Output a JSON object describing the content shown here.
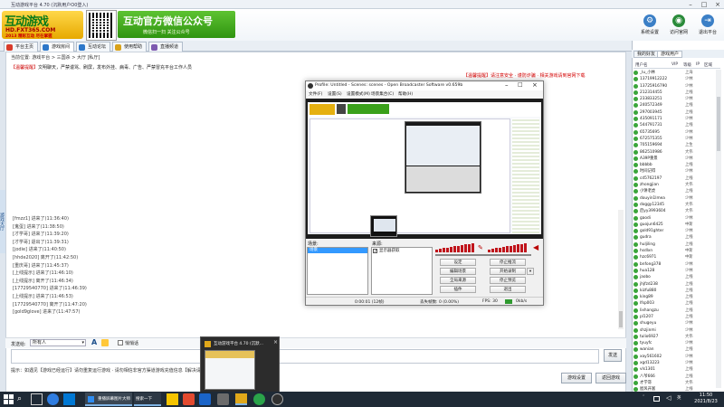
{
  "window": {
    "title": "互动游戏平台 4.70 (沉默用户O0登入)"
  },
  "banner": {
    "logo_main": "互动游戏",
    "logo_url": "HD.FXT365.COM",
    "logo_slogan": "2013 精彩互动 尽在掌握",
    "wechat_title": "互动官方微信公众号",
    "wechat_sub": "微信扫一扫 关注公众号"
  },
  "topbuttons": [
    {
      "label": "系统设置",
      "color": "#3b7fc6",
      "glyph": "⚙"
    },
    {
      "label": "访问官网",
      "color": "#2a8b3a",
      "glyph": "◉"
    },
    {
      "label": "退出平台",
      "color": "#3b7fc6",
      "glyph": "⇥"
    }
  ],
  "tabs": [
    {
      "label": "平台主页",
      "color": "#d93c2b"
    },
    {
      "label": "游戏房间",
      "color": "#2d77c9"
    },
    {
      "label": "互动论坛",
      "color": "#2d77c9"
    },
    {
      "label": "使用帮助",
      "color": "#d9a21b"
    },
    {
      "label": "直播频道",
      "color": "#7e5ab0"
    }
  ],
  "nav": "当前位置: 游戏平台 > 三国杀 > 大厅 [私厅]",
  "hint": {
    "prefix": "【温馨提醒】",
    "text": "文明聊天，严禁谩骂、刷屏，发布外挂、病毒、广告、严禁冒充平台工作人员"
  },
  "right_notice": "【温馨提醒】请注意安全 · 谨防诈骗 · 相关游戏请到官网下载",
  "side_label": "游戏大厅",
  "chat_log": [
    "[fmzz1] 进来了(11:36:40)",
    "[鬼蛋] 进来了(11:38:50)",
    "[才学哥] 进来了(11:39:20)",
    "[才学哥] 退出了(11:39:31)",
    "[jodie] 进来了(11:40:50)",
    "[hhde2020] 离开了(11:42:50)",
    "[重庆哥] 进来了(11:45:37)",
    "[上线提示] 进来了(11:46:10)",
    "[上线提示] 离开了(11:46:34)",
    "[17729540770] 进来了(11:46:39)",
    "[上线提示] 进来了(11:46:53)",
    "[17729540770] 离开了(11:47:20)",
    "[gold9glove] 进来了(11:47:57)"
  ],
  "send": {
    "label": "发送给:",
    "target": "所有人",
    "private_label": "悄悄话",
    "button": "发送"
  },
  "bottom_tip": "提示：如遇见【游戏已经运行】请勿重复运行游戏 · 请勿相信非官方渠道游戏充值信息【解决请求游戏已启动】",
  "bottom_buttons": [
    "游戏设置",
    "返回游戏"
  ],
  "right_panel": {
    "tabs": [
      "我的好友",
      "游戏用户"
    ],
    "headers": [
      "用户名",
      "VIP",
      "等级",
      "IP",
      "区域"
    ],
    "users": [
      {
        "name": "_lu_小林",
        "loc": "上海"
      },
      {
        "name": "13719912222",
        "loc": "少林"
      },
      {
        "name": "13725916790",
        "loc": "少林"
      },
      {
        "name": "212314455",
        "loc": "上线"
      },
      {
        "name": "233833251",
        "loc": "少林"
      },
      {
        "name": "240572349",
        "loc": "上线"
      },
      {
        "name": "297003945",
        "loc": "上线"
      },
      {
        "name": "435091171",
        "loc": "少林"
      },
      {
        "name": "544791731",
        "loc": "上线"
      },
      {
        "name": "65735695",
        "loc": "少林"
      },
      {
        "name": "672575355",
        "loc": "少林"
      },
      {
        "name": "705159694",
        "loc": "上生"
      },
      {
        "name": "862510986",
        "loc": "大伟"
      },
      {
        "name": "A39P重景",
        "loc": "少林"
      },
      {
        "name": "bbbbb",
        "loc": "上线"
      },
      {
        "name": "时间记得",
        "loc": "少林"
      },
      {
        "name": "cd5762197",
        "loc": "上线"
      },
      {
        "name": "zhongjian",
        "loc": "大伟"
      },
      {
        "name": "小饼老虎",
        "loc": "上线"
      },
      {
        "name": "douyin1lmea",
        "loc": "少林"
      },
      {
        "name": "doggy12345",
        "loc": "大伟"
      },
      {
        "name": "后yy3993604",
        "loc": "大伟"
      },
      {
        "name": "gaodi",
        "loc": "少林"
      },
      {
        "name": "guojun6425",
        "loc": "中斯"
      },
      {
        "name": "gold91ghter",
        "loc": "少林"
      },
      {
        "name": "gudra",
        "loc": "上线"
      },
      {
        "name": "huljiling",
        "loc": "上线"
      },
      {
        "name": "hsdlxn",
        "loc": "中斯"
      },
      {
        "name": "hzc6971",
        "loc": "中斯"
      },
      {
        "name": "bnfong378",
        "loc": "少林"
      },
      {
        "name": "hua128",
        "loc": "少林"
      },
      {
        "name": "jaobo",
        "loc": "上线"
      },
      {
        "name": "jhjfzd238",
        "loc": "上线"
      },
      {
        "name": "kizfu880",
        "loc": "上线"
      },
      {
        "name": "king89",
        "loc": "上线"
      },
      {
        "name": "lfsp003",
        "loc": "上线"
      },
      {
        "name": "lixhangzu",
        "loc": "上线"
      },
      {
        "name": "pl1207",
        "loc": "上线"
      },
      {
        "name": "shugeyu",
        "loc": "少林"
      },
      {
        "name": "shzjinmi",
        "loc": "少林"
      },
      {
        "name": "tulio6927",
        "loc": "大伟"
      },
      {
        "name": "tyuyfc",
        "loc": "少林"
      },
      {
        "name": "wanian",
        "loc": "上线"
      },
      {
        "name": "xay561602",
        "loc": "少林"
      },
      {
        "name": "xgd13223",
        "loc": "少林"
      },
      {
        "name": "vls1301",
        "loc": "上线"
      },
      {
        "name": "八爷666",
        "loc": "上线"
      },
      {
        "name": "才学哥",
        "loc": "大伟"
      },
      {
        "name": "屋风开富",
        "loc": "上线"
      },
      {
        "name": "大头",
        "loc": "上线"
      }
    ]
  },
  "obs": {
    "title": "Profile: Untitled - Scenes: scenes - Open Broadcaster Software v0.659b",
    "menu": [
      "文件(F)",
      "设置(S)",
      "设置模式(M)",
      "场景集合(C)",
      "帮助(H)"
    ],
    "scenes_label": "场景:",
    "scene_item": "场景",
    "sources_label": "来源:",
    "source_item": "显示器获取",
    "buttons": [
      "设定",
      "停止推流",
      "编辑场景",
      "开始录制",
      "全局来源",
      "停止预览",
      "插件",
      "退出"
    ],
    "status": {
      "time": "0:00:01 (12帧)",
      "dropped": "丢失帧数: 0 (0.00%)",
      "fps": "FPS: 30",
      "bitrate": "0kb/s"
    }
  },
  "hover_preview": {
    "title": "互动游戏平台 4.70 (沉默..."
  },
  "taskbar": {
    "item1": "重播屏幕图片大师",
    "item2": "搜索一下",
    "time": "11:50",
    "date": "2021/8/23"
  }
}
